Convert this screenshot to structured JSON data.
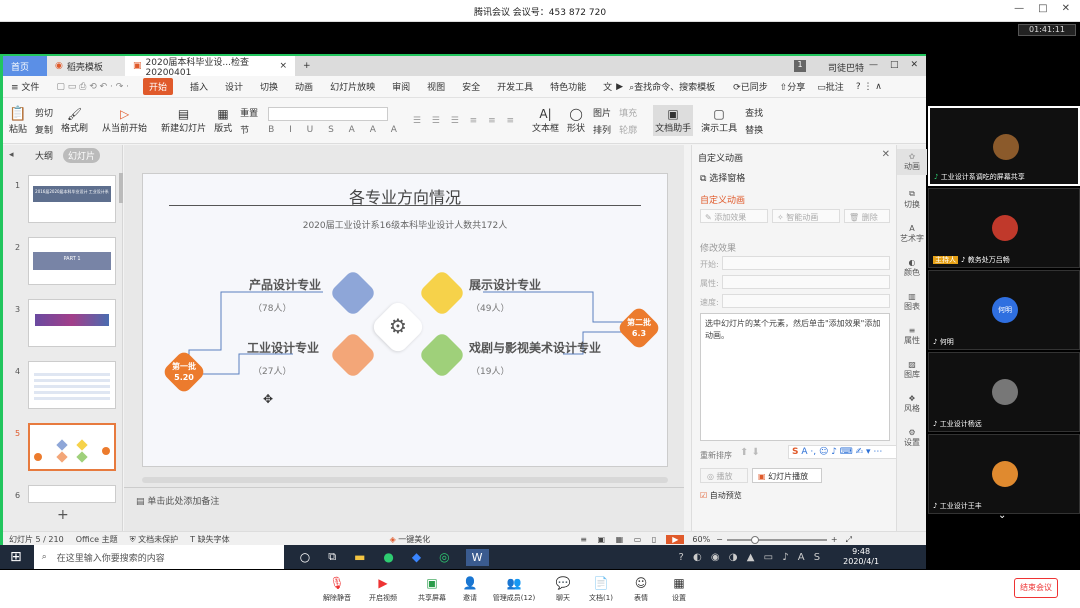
{
  "meeting": {
    "title": "腾讯会议 会议号：453 872 720",
    "timer": "01:41:11",
    "end_button": "结束会议"
  },
  "window_controls": [
    "—",
    "□",
    "✕"
  ],
  "wps": {
    "tabs": [
      "首页",
      "稻壳模板",
      "2020届本科毕业设...检查20200401",
      "+"
    ],
    "account": "司徒巴特",
    "ribbon_tabs": [
      "≡ 文件",
      "开始",
      "插入",
      "设计",
      "切换",
      "动画",
      "幻灯片放映",
      "审阅",
      "视图",
      "安全",
      "开发工具",
      "特色功能",
      "文"
    ],
    "search": "查找命令、搜索模板",
    "ribbon_right": [
      "已同步",
      "分享",
      "批注"
    ],
    "ribbon_buttons": [
      "粘贴",
      "剪切",
      "复制",
      "格式刷",
      "从当前开始",
      "新建幻灯片",
      "版式",
      "节",
      "重置",
      "文本框",
      "形状",
      "排列",
      "图片",
      "填充",
      "轮廓",
      "文档助手",
      "演示工具",
      "查找",
      "替换"
    ],
    "pane_tabs": [
      "大纲",
      "幻灯片"
    ],
    "thumb_nums": [
      "1",
      "2",
      "3",
      "4",
      "5",
      "6"
    ],
    "thumb1_text": "2016届2020届本科毕业设计 工业设计系",
    "thumb2_text": "PART 1",
    "notes_placeholder": "单击此处添加备注",
    "status": {
      "slide": "幻灯片 5 / 210",
      "theme": "Office 主题",
      "protect": "文档未保护",
      "font": "缺失字体",
      "beautify": "一键美化",
      "zoom": "60%"
    }
  },
  "slide": {
    "title": "各专业方向情况",
    "subtitle": "2020届工业设计系16级本科毕业设计人数共172人",
    "items": [
      {
        "name": "产品设计专业",
        "count": "（78人）"
      },
      {
        "name": "工业设计专业",
        "count": "（27人）"
      },
      {
        "name": "展示设计专业",
        "count": "（49人）"
      },
      {
        "name": "戏剧与影视美术设计专业",
        "count": "（19人）"
      }
    ],
    "batch1": {
      "label": "第一批",
      "date": "5.20"
    },
    "batch2": {
      "label": "第二批",
      "date": "6.3"
    }
  },
  "anim_pane": {
    "title": "自定义动画",
    "select_pane": "选择窗格",
    "custom_anim": "自定义动画",
    "add_effect": "添加效果",
    "smart_anim": "智能动画",
    "delete": "删除",
    "modify": "修改效果",
    "start_label": "开始:",
    "prop_label": "属性:",
    "speed_label": "速度:",
    "hint": "选中幻灯片的某个元素，然后单击\"添加效果\"添加动画。",
    "reorder": "重新排序",
    "play": "播放",
    "slideshow": "幻灯片播放",
    "auto_preview": "自动预览"
  },
  "side_icons": [
    "动画",
    "切换",
    "艺术字",
    "颜色",
    "图表",
    "属性",
    "图库",
    "风格",
    "设置"
  ],
  "taskbar": {
    "search": "在这里输入你要搜索的内容",
    "time": "9:48",
    "date": "2020/4/1"
  },
  "meet_buttons": [
    "解除静音",
    "开启视频",
    "共享屏幕",
    "邀请",
    "管理成员(12)",
    "聊天",
    "文档(1)",
    "表情",
    "设置"
  ],
  "participants": [
    {
      "name": "工业设计系调吃的屏幕共享",
      "color": "#8b5a2b"
    },
    {
      "name": "教务处万吕畅",
      "color": "#c0392b",
      "tag": "主持人"
    },
    {
      "name": "何明",
      "color": "#2f6fe0",
      "initial": "何明"
    },
    {
      "name": "工业设计杨远",
      "color": "#777"
    },
    {
      "name": "工业设计王丰",
      "color": "#e08a2f"
    }
  ],
  "colors": {
    "orange": "#ec7b2d",
    "blue": "#8ea6d8",
    "yellow": "#f6d24a",
    "peach": "#f3a678",
    "green": "#9fd07a",
    "accent": "#e05a2b"
  }
}
